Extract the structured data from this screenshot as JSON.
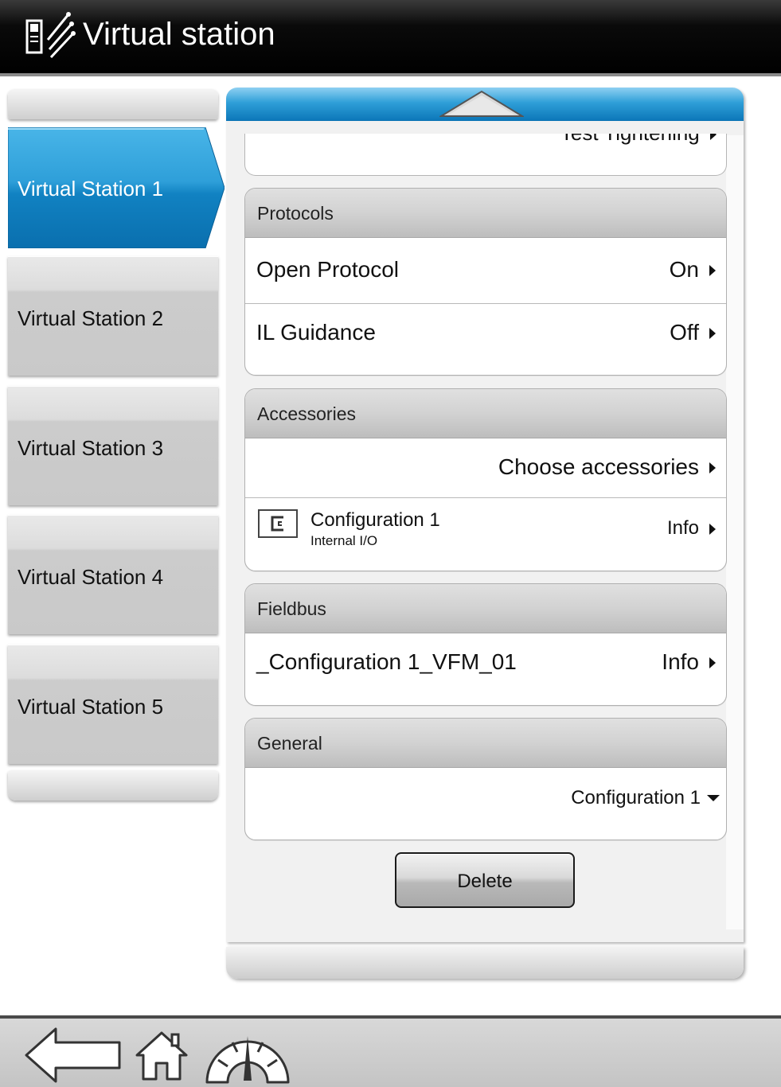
{
  "header": {
    "title": "Virtual station",
    "icon": "virtual-station-icon"
  },
  "stations": [
    {
      "label": "Virtual Station 1",
      "active": true
    },
    {
      "label": "Virtual Station 2",
      "active": false
    },
    {
      "label": "Virtual Station 3",
      "active": false
    },
    {
      "label": "Virtual Station 4",
      "active": false
    },
    {
      "label": "Virtual Station 5",
      "active": false
    }
  ],
  "clipped_row": {
    "label": "Test Tightening"
  },
  "protocols": {
    "header": "Protocols",
    "rows": [
      {
        "label": "Open Protocol",
        "value": "On"
      },
      {
        "label": "IL Guidance",
        "value": "Off"
      }
    ]
  },
  "accessories": {
    "header": "Accessories",
    "choose": "Choose accessories",
    "config": {
      "title": "Configuration 1",
      "subtitle": "Internal I/O",
      "value": "Info",
      "icon": "config-c-icon"
    }
  },
  "fieldbus": {
    "header": "Fieldbus",
    "row": {
      "label": "_Configuration 1_VFM_01",
      "value": "Info"
    }
  },
  "general": {
    "header": "General",
    "dropdown": {
      "value": "Configuration 1"
    }
  },
  "delete_label": "Delete",
  "nav": {
    "icons": [
      "back-arrow-icon",
      "home-icon",
      "gauge-icon"
    ]
  },
  "colors": {
    "accent": "#1a86c8",
    "header_bg": "#000000"
  }
}
